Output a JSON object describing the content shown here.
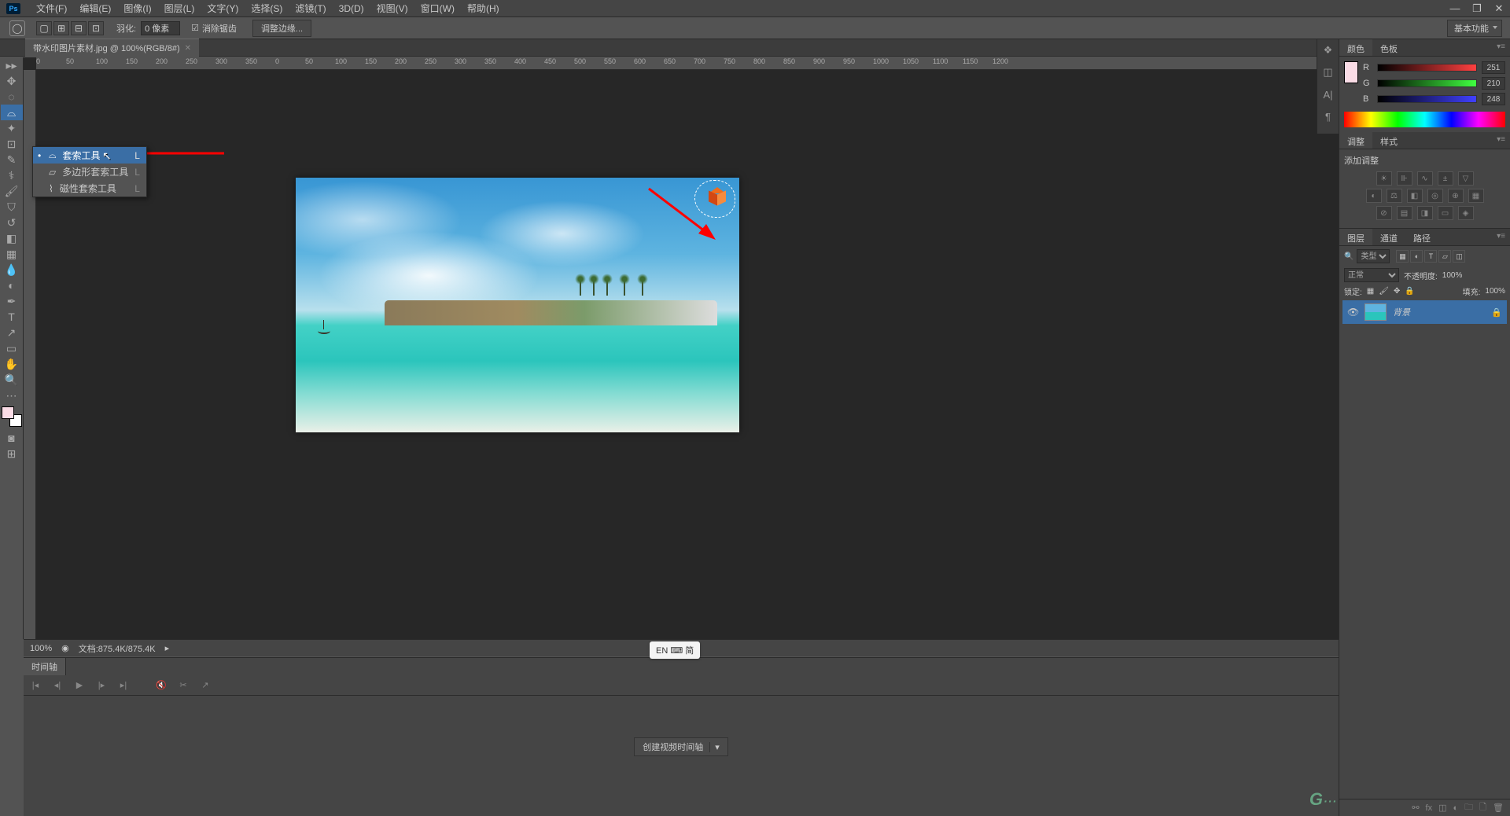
{
  "menubar": {
    "items": [
      "文件(F)",
      "编辑(E)",
      "图像(I)",
      "图层(L)",
      "文字(Y)",
      "选择(S)",
      "滤镜(T)",
      "3D(D)",
      "视图(V)",
      "窗口(W)",
      "帮助(H)"
    ]
  },
  "optionsbar": {
    "feather_label": "羽化:",
    "feather_value": "0 像素",
    "antialias_label": "消除锯齿",
    "refine_edge": "调整边缘...",
    "workspace": "基本功能"
  },
  "doctab": {
    "title": "带水印图片素材.jpg @ 100%(RGB/8#)"
  },
  "tool_flyout": {
    "items": [
      {
        "label": "套索工具",
        "shortcut": "L",
        "selected": true
      },
      {
        "label": "多边形套索工具",
        "shortcut": "L",
        "selected": false
      },
      {
        "label": "磁性套索工具",
        "shortcut": "L",
        "selected": false
      }
    ]
  },
  "statusbar": {
    "zoom": "100%",
    "docinfo": "文档:875.4K/875.4K"
  },
  "timeline": {
    "tab": "时间轴",
    "create_btn": "创建视频时间轴"
  },
  "color_panel": {
    "tabs": [
      "颜色",
      "色板"
    ],
    "r_label": "R",
    "r_value": "251",
    "g_label": "G",
    "g_value": "210",
    "b_label": "B",
    "b_value": "248"
  },
  "adjustments_panel": {
    "tabs": [
      "调整",
      "样式"
    ],
    "title": "添加调整"
  },
  "layers_panel": {
    "tabs": [
      "图层",
      "通道",
      "路径"
    ],
    "filter_label": "类型",
    "blend_mode": "正常",
    "opacity_label": "不透明度:",
    "opacity_value": "100%",
    "lock_label": "锁定:",
    "fill_label": "填充:",
    "fill_value": "100%",
    "layer_name": "背景"
  },
  "ruler_ticks": [
    "0",
    "50",
    "100",
    "150",
    "200",
    "250",
    "300",
    "350",
    "0",
    "50",
    "100",
    "150",
    "200",
    "250",
    "300",
    "350",
    "400",
    "450",
    "500",
    "550",
    "600",
    "650",
    "700",
    "750",
    "800",
    "850",
    "900",
    "950",
    "1000",
    "1050",
    "1100",
    "1150",
    "1200"
  ],
  "ime": {
    "text": "EN ⌨ 简"
  },
  "chart_data": null
}
